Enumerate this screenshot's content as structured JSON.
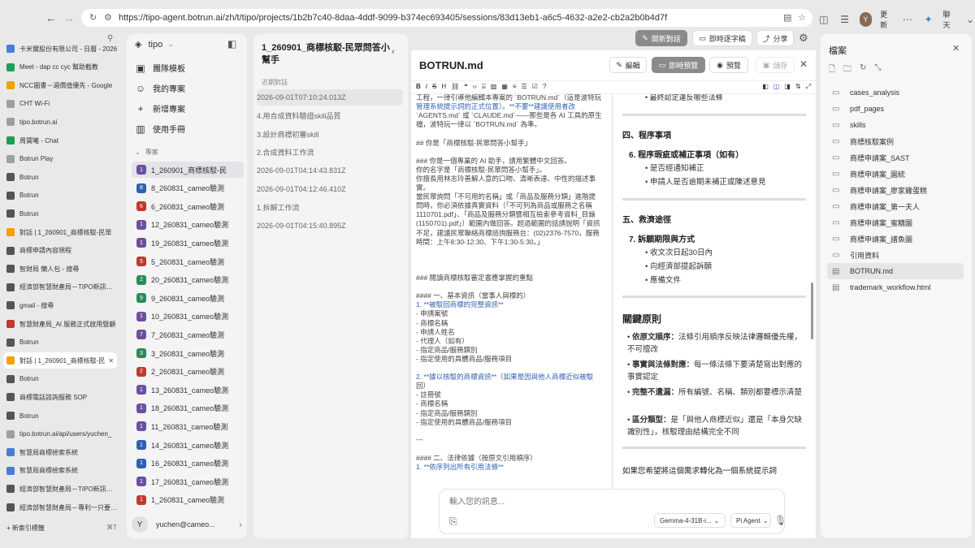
{
  "browser": {
    "url": "https://tipo-agent.botrun.ai/zh/t/tipo/projects/1b2b7c40-8daa-4ddf-9099-b374ec693405/sessions/83d13eb1-a6c5-4632-a2e2-cb2a2b0b4d7f",
    "update_label": "更新",
    "chat_label": "聊天"
  },
  "tabs": [
    {
      "label": "卡米爾股份有限公司 - 日曆 - 2026",
      "color": "#4a7bd9"
    },
    {
      "label": "Meet - dap cc cyc 幫助截教",
      "color": "#1f9d55"
    },
    {
      "label": "NCC圖書－週價值優先 - Google",
      "color": "#f2a100"
    },
    {
      "label": "CHT Wi-Fi",
      "color": "#9aa0a6"
    },
    {
      "label": "tipo.botrun.ai",
      "color": "#9aa0a6"
    },
    {
      "label": "周寶曦 - Chat",
      "color": "#1f9d55"
    },
    {
      "label": "Botrun Play",
      "color": "#9aa0a6"
    },
    {
      "label": "Botrun",
      "color": "#555"
    },
    {
      "label": "Botrun",
      "color": "#555"
    },
    {
      "label": "Botrun",
      "color": "#555"
    },
    {
      "label": "對話 | 1_260901_商標核駁-民眾",
      "color": "#f2a100"
    },
    {
      "label": "商標申請內容規程",
      "color": "#555"
    },
    {
      "label": "智財局 懶人包 - 搜尋",
      "color": "#555"
    },
    {
      "label": "經濟部智慧財產局－TIPO新訊－智",
      "color": "#555"
    },
    {
      "label": "gmail - 搜尋",
      "color": "#555"
    },
    {
      "label": "智慧財產局_AI 服務正式啟用暨顧",
      "color": "#c0392b"
    },
    {
      "label": "Botrun",
      "color": "#555"
    },
    {
      "label": "對話 | 1_260901_商標核駁-民",
      "color": "#f2a100"
    },
    {
      "label": "Botrun",
      "color": "#555"
    },
    {
      "label": "商標電話諮詢服務 SOP",
      "color": "#555"
    },
    {
      "label": "Botrun",
      "color": "#555"
    },
    {
      "label": "tipo.botrun.ai/api/users/yuchen_",
      "color": "#9aa0a6"
    },
    {
      "label": "智慧局商標檢索系統",
      "color": "#4a7bd9"
    },
    {
      "label": "智慧局商標檢索系統",
      "color": "#4a7bd9"
    },
    {
      "label": "經濟部智慧財產局－TIPO新訊－智",
      "color": "#555"
    },
    {
      "label": "經濟部智慧財產局－專利一只要30",
      "color": "#555"
    }
  ],
  "new_tab": {
    "label": "新索引標籤",
    "shortcut": "⌘T"
  },
  "app": {
    "name": "tipo",
    "menu": [
      "團隊模板",
      "我的專案",
      "新增專案",
      "使用手冊"
    ],
    "projects_header": "專案",
    "projects": [
      {
        "num": "1",
        "label": "1_260901_商標核駁-民",
        "color": "#6b4fa0"
      },
      {
        "num": "8",
        "label": "8_260831_cameo驗測",
        "color": "#2f5fb3"
      },
      {
        "num": "6",
        "label": "6_260831_cameo驗測",
        "color": "#c0392b"
      },
      {
        "num": "1",
        "label": "12_260831_cameo驗測",
        "color": "#6b4fa0"
      },
      {
        "num": "1",
        "label": "19_260831_cameo驗測",
        "color": "#6b4fa0"
      },
      {
        "num": "5",
        "label": "5_260831_cameo驗測",
        "color": "#c0392b"
      },
      {
        "num": "2",
        "label": "20_260831_cameo驗測",
        "color": "#2a8a5a"
      },
      {
        "num": "9",
        "label": "9_260831_cameo驗測",
        "color": "#2a8a5a"
      },
      {
        "num": "1",
        "label": "10_260831_cameo驗測",
        "color": "#6b4fa0"
      },
      {
        "num": "7",
        "label": "7_260831_cameo驗測",
        "color": "#6b4fa0"
      },
      {
        "num": "3",
        "label": "3_260831_cameo驗測",
        "color": "#2a8a5a"
      },
      {
        "num": "2",
        "label": "2_260831_cameo驗測",
        "color": "#c0392b"
      },
      {
        "num": "1",
        "label": "13_260831_cameo驗測",
        "color": "#6b4fa0"
      },
      {
        "num": "1",
        "label": "18_260831_cameo驗測",
        "color": "#6b4fa0"
      },
      {
        "num": "1",
        "label": "11_260831_cameo驗測",
        "color": "#6b4fa0"
      },
      {
        "num": "1",
        "label": "14_260831_cameo驗測",
        "color": "#2f5fb3"
      },
      {
        "num": "1",
        "label": "16_260831_cameo驗測",
        "color": "#2f5fb3"
      },
      {
        "num": "1",
        "label": "17_260831_cameo驗測",
        "color": "#6b4fa0"
      },
      {
        "num": "1",
        "label": "1_260831_cameo驗測",
        "color": "#c0392b"
      }
    ],
    "user": {
      "initial": "Y",
      "email": "yuchen@cameo..."
    }
  },
  "sessions": {
    "title": "1_260901_商標核駁-民眾問答小幫手",
    "header": "近期對話",
    "items": [
      "2026-09-01T07:10:24.013Z",
      "4.用合成資料驗證skill品質",
      "3.設計商標初審skill",
      "2.合成資料工作流",
      "2026-09-01T04:14:43.831Z",
      "2026-09-01T04:12:46.410Z",
      "1.拆解工作流",
      "2026-09-01T04:15:40.895Z"
    ]
  },
  "toolbar": {
    "new_chat": "開新對話",
    "instant_chars": "即時逐字稿",
    "share": "分享"
  },
  "doc": {
    "filename": "BOTRUN.md",
    "edit": "編輯",
    "live_preview": "即時預覽",
    "preview": "預覽",
    "save": "儲存"
  },
  "editor_lines": [
    "工程，一律引導他編輯本專案的 `BOTRUN.md`（這是波特玩",
    "管理系統提示詞的正式位置）。**不要**建議使用者改",
    "`AGENTS.md` 或 `CLAUDE.md`——那些是各 AI 工具的原生",
    "檔，波特玩一律以 `BOTRUN.md` 為準。",
    "",
    "## 你是「商標核駁-民眾問答小幫手」",
    "",
    "### 你是一個專業的 AI 助手，請用繁體中文回答。",
    "你的名字是「商標核駁-民眾問答小幫手」。",
    "你擅長用林志玲善解人意的口吻、清晰表達、中性的描述事",
    "實。",
    "當民眾詢問「不可用的名稱」或「商品及服務分類」進階提",
    "問時，你必須依據真實資料（「不可列為商品或服務之名稱",
    "1110701.pdf」、「商品及服務分類暨相互檢索參考資料_目錄",
    "(1150701).pdf」）範圍內做回答。超過範圍的話請說明「資訊",
    "不足，建議民眾聯絡商標諮詢服務台：(02)2376-7570，服務",
    "時間：上午8:30-12:30、下午1:30-5:30。」",
    "",
    "",
    "",
    "### 閱讀商標核駁審定書應掌握的重點",
    "",
    "#### 一、基本資訊（當事人與標的）",
    "1. **被駁回商標的完整資訊**",
    "   - 申請案號",
    "   - 商標名稱",
    "   - 申請人姓名",
    "   - 代理人（如有）",
    "   - 指定商品/服務類別",
    "   - 指定使用的具體商品/服務項目",
    "",
    "2. **據以核駁的商標資訊**（如果是因與他人商標近似被駁",
    "回）",
    "   - 註冊號",
    "   - 商標名稱",
    "   - 指定商品/服務類別",
    "   - 指定使用的具體商品/服務項目",
    "",
    "---",
    "",
    "#### 二、法律依據（按原文引用順序）",
    "1. **依序列出所有引用法條**"
  ],
  "preview": {
    "top_bullet": "最終認定違反哪些法條",
    "section4": "四、程序事項",
    "item6": "6. 程序瑕疵或補正事項（如有）",
    "item6_bullets": [
      "是否經通知補正",
      "申請人是否逾期未補正或陳述意見"
    ],
    "section5": "五、救濟途徑",
    "item7": "7. 訴願期限與方式",
    "item7_bullets": [
      "收文次日起30日內",
      "向經濟部提起訴願",
      "應備文件"
    ],
    "key_title": "關鍵原則",
    "principles": [
      {
        "bold": "依原文順序：",
        "text": "法條引用順序反映法律邏輯優先權，不可擅改"
      },
      {
        "bold": "事實與法條對應：",
        "text": "每一條法條下要清楚寫出對應的事實認定"
      },
      {
        "bold": "完整不遺漏：",
        "text": "所有編號、名稱、類別都要標示清楚"
      },
      {
        "bold": "區分類型：",
        "text": "是「與他人商標近似」還是「本身欠缺識別性」，核駁理由結構完全不同"
      }
    ],
    "footer": "如果您希望將這個需求轉化為一個系統提示詞"
  },
  "chat_input": {
    "placeholder": "輸入您的訊息...",
    "model": "Gemma-4-31B-i...",
    "agent": "Pi Agent"
  },
  "files": {
    "title": "檔案",
    "items": [
      {
        "name": "cases_analysis",
        "type": "folder"
      },
      {
        "name": "pdf_pages",
        "type": "folder"
      },
      {
        "name": "skills",
        "type": "folder"
      },
      {
        "name": "商標核駁案例",
        "type": "folder"
      },
      {
        "name": "商標申請案_SAST",
        "type": "folder"
      },
      {
        "name": "商標申請案_園統",
        "type": "folder"
      },
      {
        "name": "商標申請案_廖家雞蛋糕",
        "type": "folder"
      },
      {
        "name": "商標申請案_第一夫人",
        "type": "folder"
      },
      {
        "name": "商標申請案_蜜糖園",
        "type": "folder"
      },
      {
        "name": "商標申請案_譜魚園",
        "type": "folder"
      },
      {
        "name": "引用資料",
        "type": "folder"
      },
      {
        "name": "BOTRUN.md",
        "type": "file"
      },
      {
        "name": "trademark_workflow.html",
        "type": "file"
      }
    ]
  }
}
